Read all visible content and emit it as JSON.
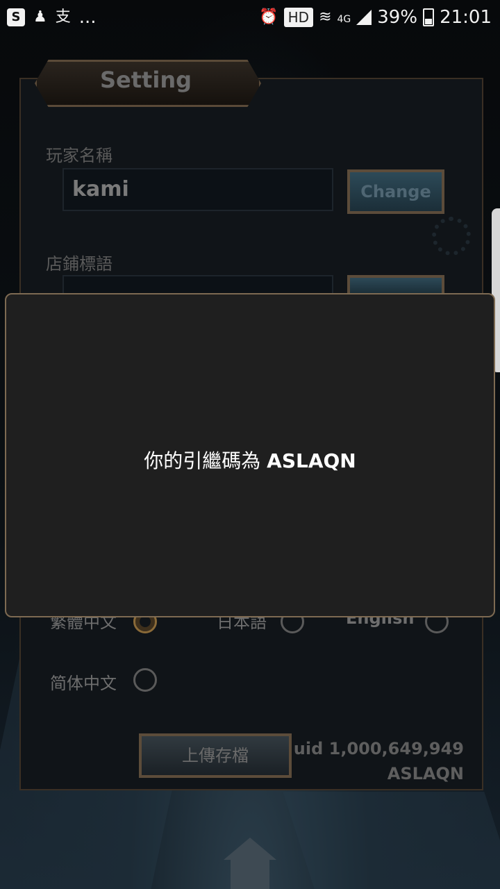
{
  "status_bar": {
    "left_icons": [
      "s-app-icon",
      "figure-icon",
      "zhi-char-icon"
    ],
    "left_chars": [
      "S",
      "♟",
      "支"
    ],
    "overflow": "...",
    "hd": "HD",
    "network": "4G",
    "battery": "39%",
    "time": "21:01"
  },
  "settings": {
    "title": "Setting",
    "player_name_label": "玩家名稱",
    "player_name_value": "kami",
    "change_label": "Change",
    "shop_tag_label": "店鋪標語",
    "shop_tag_value": "",
    "languages": [
      {
        "label": "繁體中文",
        "selected": true
      },
      {
        "label": "日本語",
        "selected": false
      },
      {
        "label": "English",
        "selected": false
      },
      {
        "label": "简体中文",
        "selected": false
      }
    ],
    "upload_label": "上傳存檔",
    "uid_line": "uid 1,000,649,949",
    "code_line": "ASLAQN"
  },
  "dialog": {
    "message_prefix": "你的引繼碼為",
    "code": "ASLAQN"
  }
}
